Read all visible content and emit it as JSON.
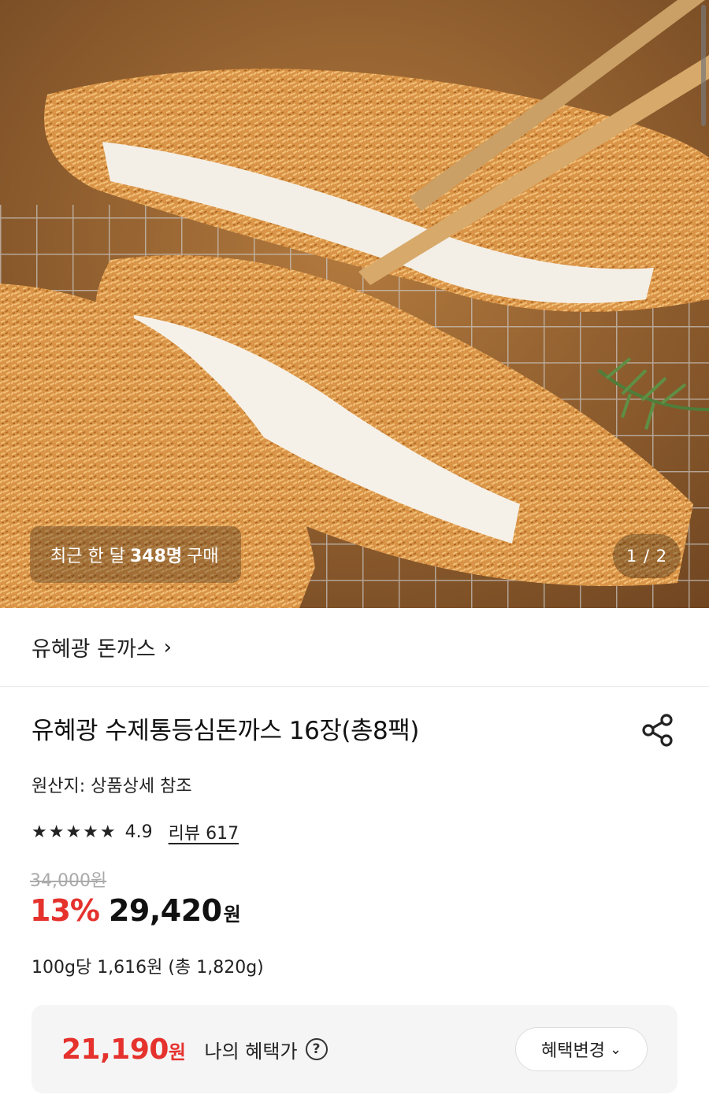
{
  "hero": {
    "purchase_prefix": "최근 한 달",
    "purchase_count": "348명",
    "purchase_suffix": "구매",
    "pager": "1 / 2"
  },
  "brand": {
    "name": "유혜광 돈까스",
    "chevron": "›"
  },
  "product": {
    "title": "유혜광 수제통등심돈까스 16장(총8팩)",
    "share_icon": "share-icon",
    "origin": "원산지: 상품상세 참조",
    "stars": "★★★★★",
    "rating": "4.9",
    "review": "리뷰 617",
    "original_price": "34,000원",
    "discount": "13%",
    "price": "29,420",
    "price_unit": "원",
    "unit_price": "100g당 1,616원 (총 1,820g)"
  },
  "benefit": {
    "price": "21,190",
    "price_unit": "원",
    "label": "나의 혜택가",
    "help": "?",
    "button": "혜택변경",
    "button_chevron": "⌄"
  },
  "colors": {
    "accent_red": "#e5322d",
    "benefit_bg": "#f5f5f5"
  }
}
